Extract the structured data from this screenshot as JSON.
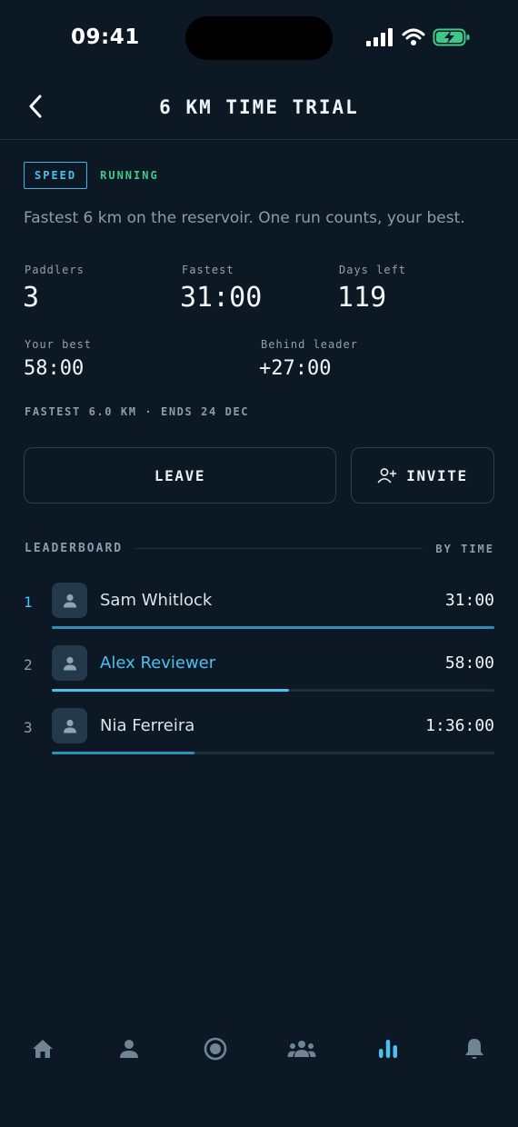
{
  "status": {
    "time": "09:41"
  },
  "header": {
    "title": "6 KM TIME TRIAL"
  },
  "tags": {
    "type": "SPEED",
    "state": "RUNNING"
  },
  "description": "Fastest 6 km on the reservoir. One run counts, your best.",
  "stats": {
    "paddlers": {
      "label": "Paddlers",
      "value": "3"
    },
    "fastest": {
      "label": "Fastest",
      "value": "31:00"
    },
    "days_left": {
      "label": "Days left",
      "value": "119"
    },
    "your_best": {
      "label": "Your best",
      "value": "58:00"
    },
    "behind_leader": {
      "label": "Behind leader",
      "value": "+27:00"
    }
  },
  "fine_print": "FASTEST 6.0 KM · ENDS 24 DEC",
  "actions": {
    "leave": "LEAVE",
    "invite": "INVITE"
  },
  "leaderboard": {
    "title": "LEADERBOARD",
    "sort": "BY TIME",
    "rows": [
      {
        "rank": "1",
        "name": "Sam Whitlock",
        "time": "31:00",
        "progress": 1.0,
        "is_me": false
      },
      {
        "rank": "2",
        "name": "Alex Reviewer",
        "time": "58:00",
        "progress": 0.535,
        "is_me": true
      },
      {
        "rank": "3",
        "name": "Nia Ferreira",
        "time": "1:36:00",
        "progress": 0.323,
        "is_me": false
      }
    ]
  },
  "nav": {
    "items": [
      "home-icon",
      "profile-icon",
      "record-icon",
      "group-icon",
      "leaderboard-icon",
      "bell-icon"
    ],
    "active": "leaderboard-icon"
  },
  "colors": {
    "background": "#0c1924",
    "accent": "#4cc0ee",
    "running": "#3ec98a",
    "bar": "#2f8fb6"
  }
}
